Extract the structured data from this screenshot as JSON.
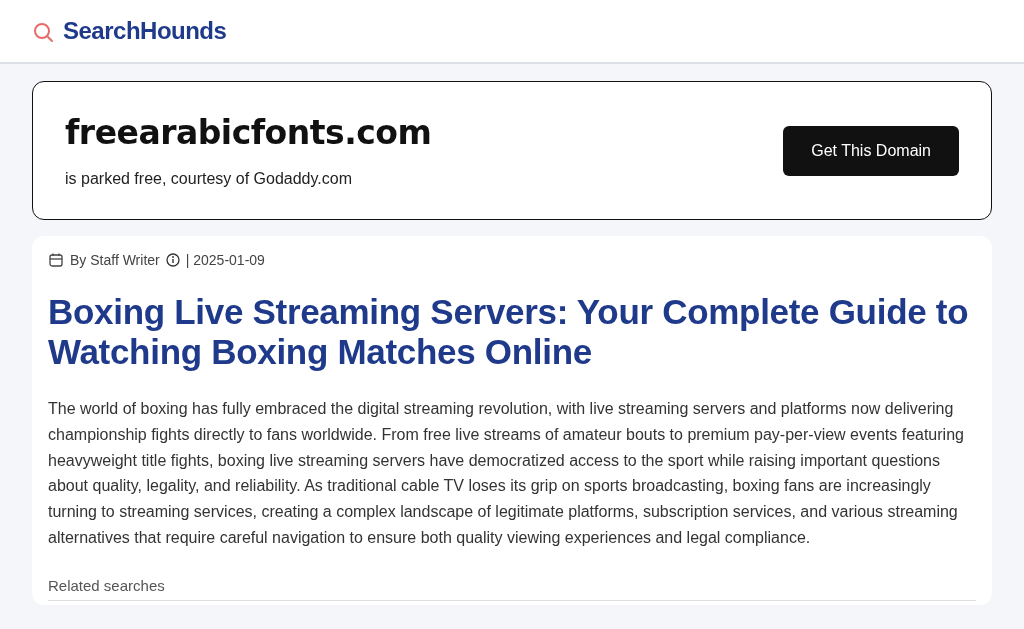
{
  "header": {
    "brand": "SearchHounds"
  },
  "domain_banner": {
    "domain": "freearabicfonts.com",
    "subtitle": "is parked free, courtesy of Godaddy.com",
    "button": "Get This Domain"
  },
  "article": {
    "author": "By Staff Writer",
    "date": "| 2025-01-09",
    "title": "Boxing Live Streaming Servers: Your Complete Guide to Watching Boxing Matches Online",
    "body": "The world of boxing has fully embraced the digital streaming revolution, with live streaming servers and platforms now delivering championship fights directly to fans worldwide. From free live streams of amateur bouts to premium pay-per-view events featuring heavyweight title fights, boxing live streaming servers have democratized access to the sport while raising important questions about quality, legality, and reliability. As traditional cable TV loses its grip on sports broadcasting, boxing fans are increasingly turning to streaming services, creating a complex landscape of legitimate platforms, subscription services, and various streaming alternatives that require careful navigation to ensure both quality viewing experiences and legal compliance.",
    "related_heading": "Related searches"
  }
}
